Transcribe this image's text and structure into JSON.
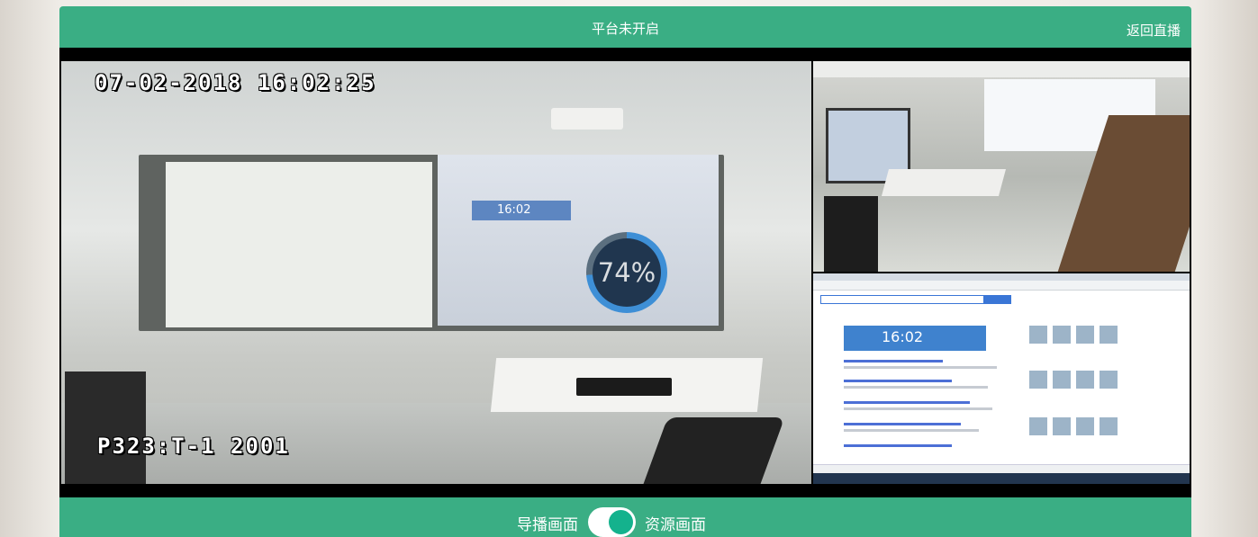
{
  "header": {
    "title": "平台未开启",
    "back_label": "返回直播"
  },
  "main_camera": {
    "timestamp": "07-02-2018 16:02:25",
    "channel_name": "P323:T-1  2001",
    "loading_percent_label": "74%",
    "loading_progress": 0.74,
    "projected_clock": "16:02"
  },
  "screen_share": {
    "clock": "16:02"
  },
  "footer": {
    "left_label": "导播画面",
    "right_label": "资源画面",
    "toggle_on": true
  },
  "colors": {
    "accent": "#3aae84",
    "toggle_knob": "#14b28d",
    "progress_ring": "#3e8fd6"
  }
}
